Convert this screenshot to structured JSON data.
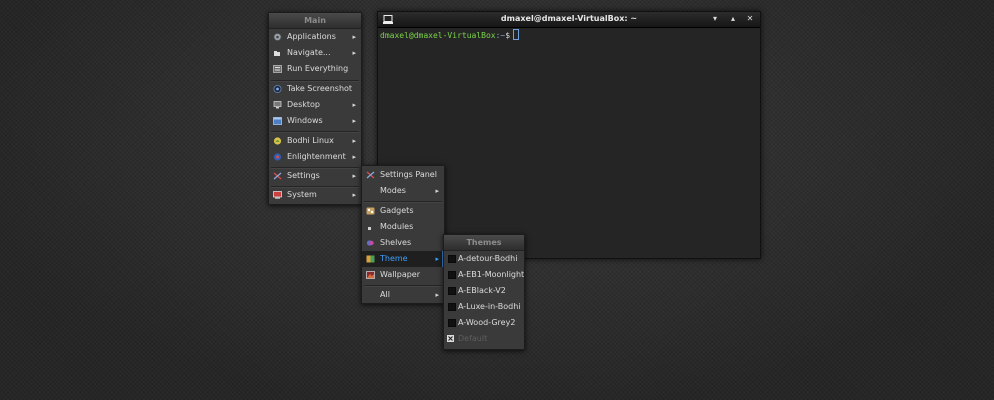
{
  "terminal": {
    "title": "dmaxel@dmaxel-VirtualBox: ~",
    "prompt_user": "dmaxel@dmaxel-VirtualBox",
    "prompt_path": ":~",
    "prompt_symbol": "$",
    "controls": {
      "minimize": "▾",
      "maximize": "▴",
      "close": "✕"
    }
  },
  "main_menu": {
    "title": "Main",
    "items": [
      {
        "label": "Applications",
        "icon": "applications-icon",
        "submenu": true
      },
      {
        "label": "Navigate...",
        "icon": "navigate-icon",
        "submenu": true
      },
      {
        "label": "Run Everything",
        "icon": "run-everything-icon",
        "submenu": false
      },
      {
        "label": "Take Screenshot",
        "icon": "screenshot-icon",
        "submenu": false
      },
      {
        "label": "Desktop",
        "icon": "desktop-icon",
        "submenu": true
      },
      {
        "label": "Windows",
        "icon": "windows-icon",
        "submenu": true
      },
      {
        "label": "Bodhi Linux",
        "icon": "bodhi-icon",
        "submenu": true
      },
      {
        "label": "Enlightenment",
        "icon": "enlightenment-icon",
        "submenu": true
      },
      {
        "label": "Settings",
        "icon": "settings-icon",
        "submenu": true
      },
      {
        "label": "System",
        "icon": "system-icon",
        "submenu": true
      }
    ]
  },
  "settings_menu": {
    "items": [
      {
        "label": "Settings Panel",
        "icon": "settings-panel-icon"
      },
      {
        "label": "Modes",
        "submenu": true
      },
      {
        "label": "Gadgets",
        "icon": "gadgets-icon"
      },
      {
        "label": "Modules",
        "icon": "modules-icon"
      },
      {
        "label": "Shelves",
        "icon": "shelves-icon"
      },
      {
        "label": "Theme",
        "icon": "theme-icon",
        "submenu": true,
        "selected": true
      },
      {
        "label": "Wallpaper",
        "icon": "wallpaper-icon"
      },
      {
        "label": "All",
        "submenu": true
      }
    ]
  },
  "themes_menu": {
    "title": "Themes",
    "items": [
      {
        "label": "A-detour-Bodhi"
      },
      {
        "label": "A-EB1-Moonlight"
      },
      {
        "label": "A-EBlack-V2"
      },
      {
        "label": "A-Luxe-in-Bodhi"
      },
      {
        "label": "A-Wood-Grey2"
      },
      {
        "label": "Default",
        "disabled": true
      }
    ]
  },
  "colors": {
    "highlight": "#3ea0ff",
    "prompt_user": "#7cd44a",
    "prompt_path": "#8aa9d8"
  }
}
